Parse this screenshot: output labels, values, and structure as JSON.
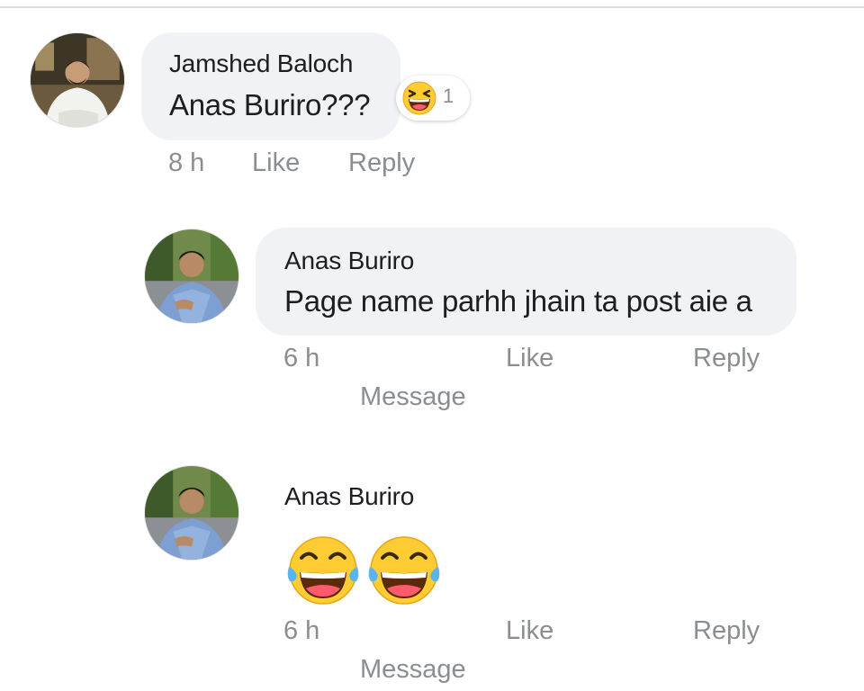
{
  "comments": [
    {
      "author": "Jamshed Baloch",
      "text": "Anas Buriro???",
      "reaction": {
        "icon": "laughing-squint-icon",
        "count": "1"
      },
      "time": "8 h",
      "like_label": "Like",
      "reply_label": "Reply"
    },
    {
      "author": "Anas Buriro",
      "text": "Page name parhh jhain ta post aie a",
      "time": "6 h",
      "like_label": "Like",
      "reply_label": "Reply",
      "message_label": "Message"
    },
    {
      "author": "Anas Buriro",
      "emojis": [
        "face-with-tears-of-joy-icon",
        "face-with-tears-of-joy-icon"
      ],
      "time": "6 h",
      "like_label": "Like",
      "reply_label": "Reply",
      "message_label": "Message"
    }
  ],
  "colors": {
    "bubble_bg": "#f0f2f5",
    "meta_text": "#8a8d91",
    "primary_text": "#1c1e21",
    "emoji_yellow": "#ffcc33",
    "tear_blue": "#5ab4f0"
  }
}
